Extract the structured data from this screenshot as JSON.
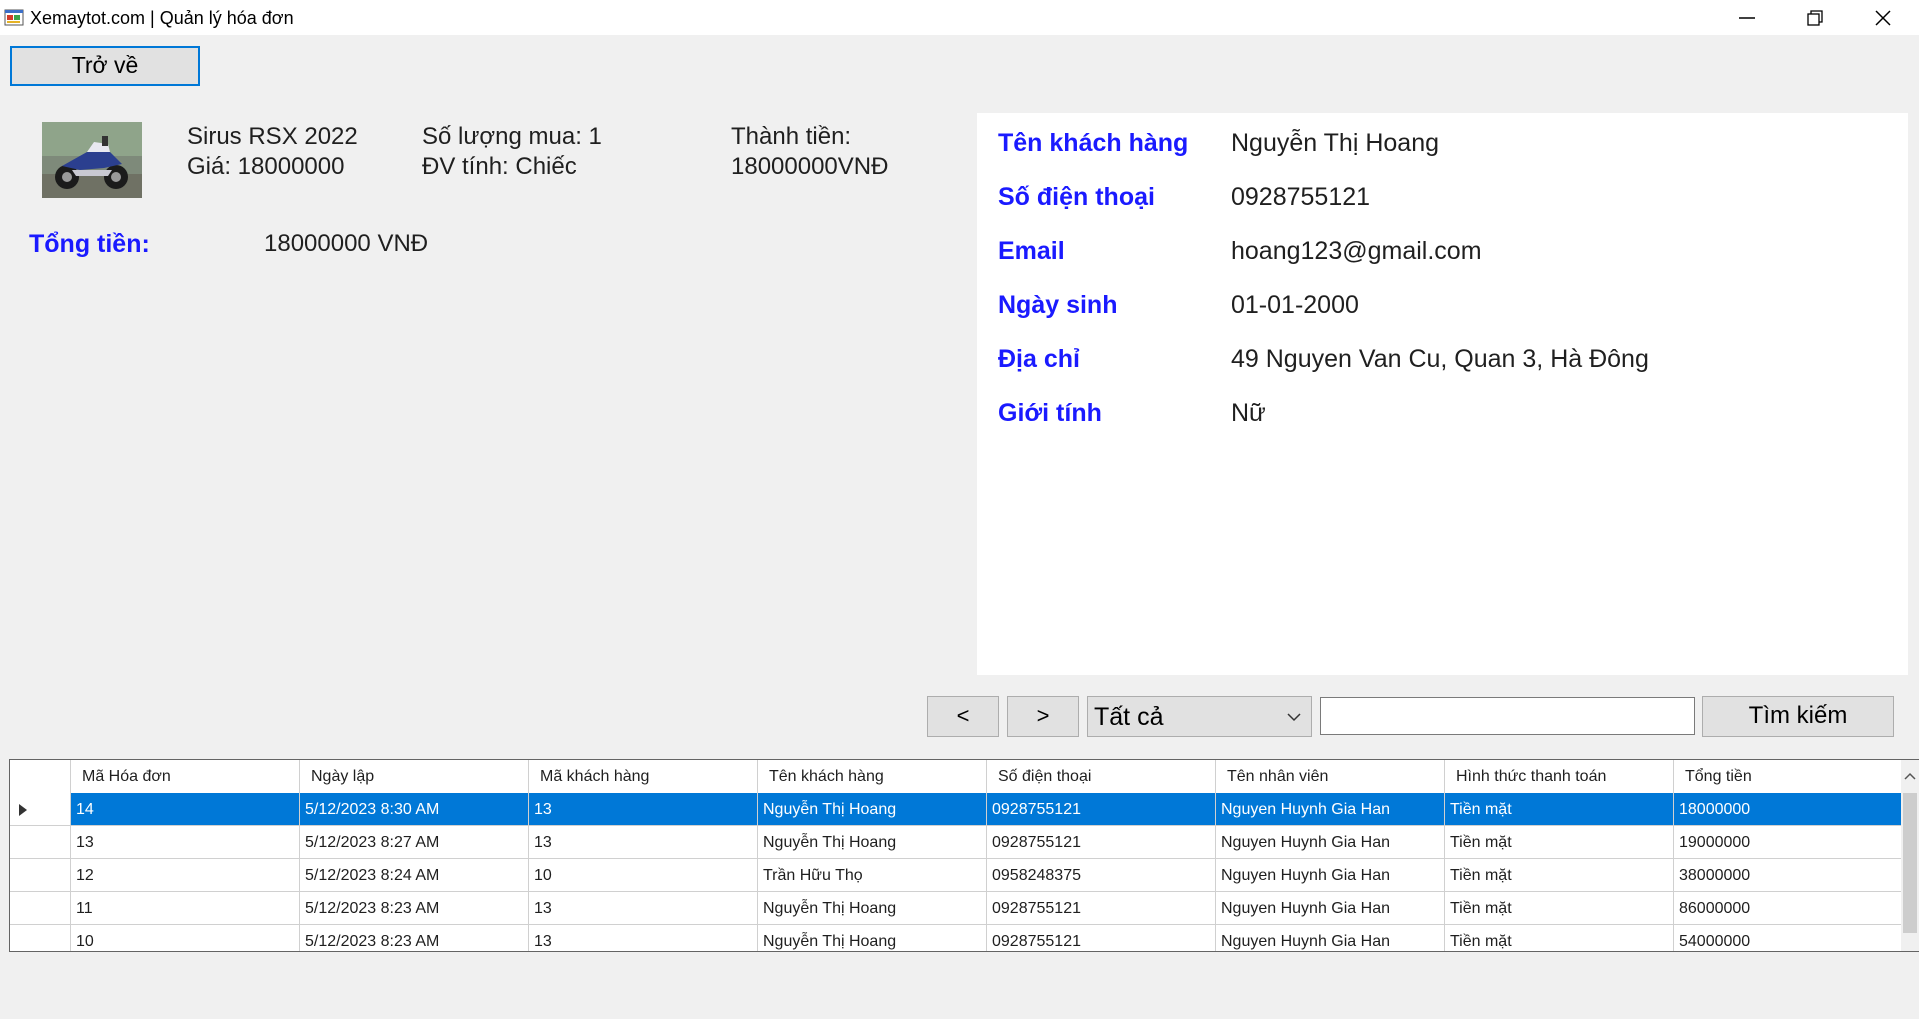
{
  "window": {
    "title": "Xemaytot.com | Quản lý hóa đơn",
    "icon": "app-window-icon",
    "controls": [
      "minimize-icon",
      "restore-icon",
      "close-icon"
    ]
  },
  "toolbar": {
    "back_label": "Trở về"
  },
  "product": {
    "image": "motorbike-photo",
    "name": "Sirus RSX 2022",
    "price": "Giá: 18000000",
    "quantity": "Số lượng mua: 1",
    "unit": "ĐV tính: Chiếc",
    "subtotal_label": "Thành tiền:",
    "subtotal_value": "18000000VNĐ"
  },
  "total": {
    "label": "Tổng tiền:",
    "value": "18000000 VNĐ"
  },
  "customer": {
    "name_label": "Tên khách hàng",
    "name": "Nguyễn Thị Hoang",
    "phone_label": "Số điện thoại",
    "phone": "0928755121",
    "email_label": "Email",
    "email": "hoang123@gmail.com",
    "dob_label": "Ngày sinh",
    "dob": "01-01-2000",
    "address_label": "Địa chỉ",
    "address": "49 Nguyen Van Cu, Quan 3, Hà Đông",
    "gender_label": "Giới tính",
    "gender": "Nữ"
  },
  "search": {
    "prev_label": "<",
    "next_label": ">",
    "filter_value": "Tất cả",
    "query": "",
    "button_label": "Tìm kiếm"
  },
  "grid": {
    "columns": [
      "Mã Hóa đơn",
      "Ngày lập",
      "Mã khách hàng",
      "Tên khách hàng",
      "Số điện thoại",
      "Tên nhân viên",
      "Hình thức thanh toán",
      "Tổng tiền"
    ],
    "rows": [
      [
        "14",
        "5/12/2023 8:30 AM",
        "13",
        "Nguyễn Thị Hoang",
        "0928755121",
        "Nguyen Huynh Gia Han",
        "Tiền mặt",
        "18000000"
      ],
      [
        "13",
        "5/12/2023 8:27 AM",
        "13",
        "Nguyễn Thị Hoang",
        "0928755121",
        "Nguyen Huynh Gia Han",
        "Tiền mặt",
        "19000000"
      ],
      [
        "12",
        "5/12/2023 8:24 AM",
        "10",
        "Trần Hữu Thọ",
        "0958248375",
        "Nguyen Huynh Gia Han",
        "Tiền mặt",
        "38000000"
      ],
      [
        "11",
        "5/12/2023 8:23 AM",
        "13",
        "Nguyễn Thị Hoang",
        "0928755121",
        "Nguyen Huynh Gia Han",
        "Tiền mặt",
        "86000000"
      ],
      [
        "10",
        "5/12/2023 8:23 AM",
        "13",
        "Nguyễn Thị Hoang",
        "0928755121",
        "Nguyen Huynh Gia Han",
        "Tiền mặt",
        "54000000"
      ]
    ],
    "selected_row": 0,
    "selection_color": "#0078d7"
  },
  "colors": {
    "label_blue": "#1a1aff",
    "accent": "#0078d7"
  }
}
